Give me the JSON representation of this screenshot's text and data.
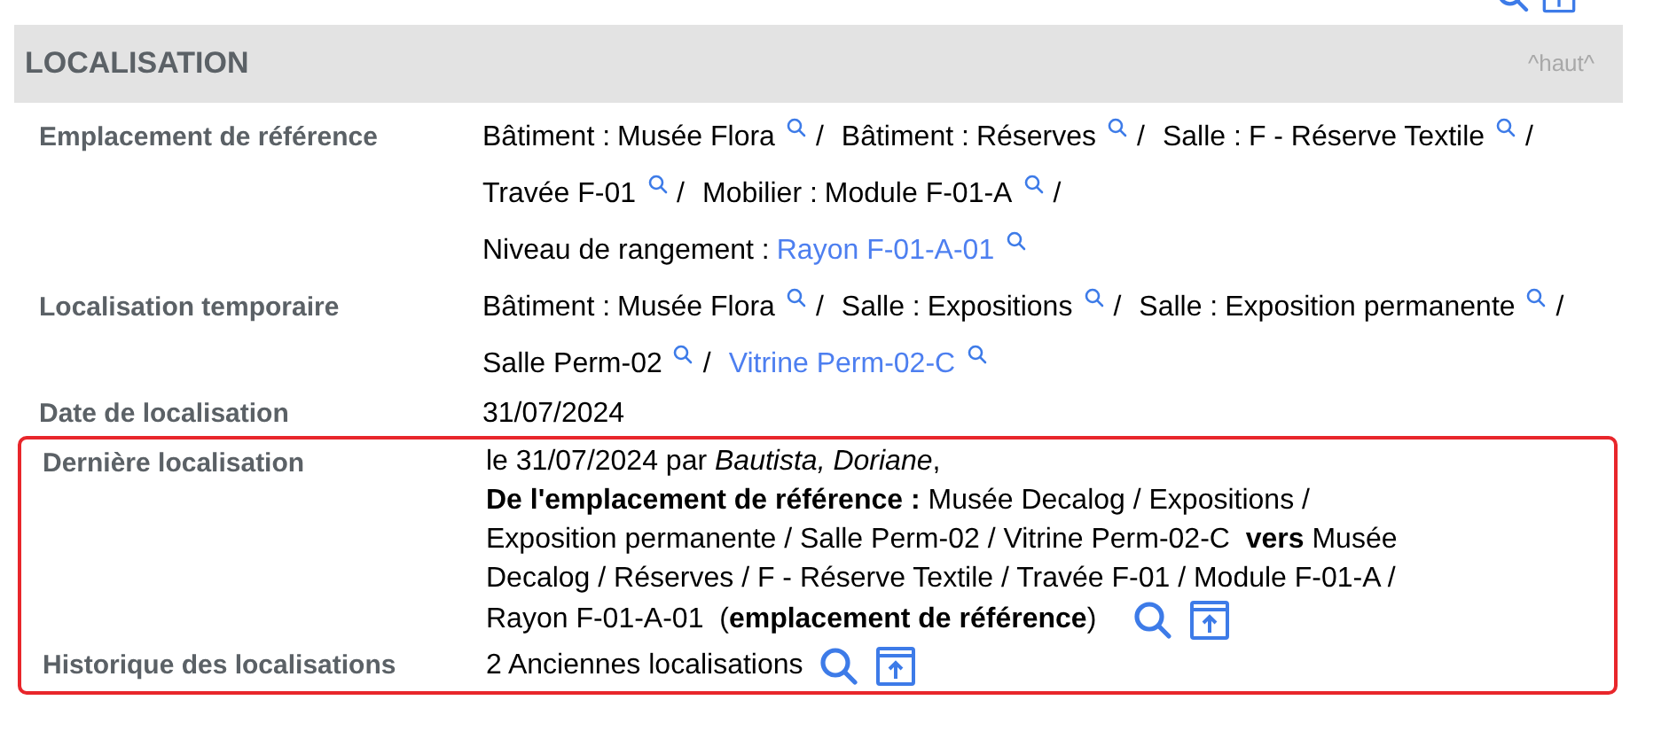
{
  "section": {
    "title": "LOCALISATION",
    "top_link": "^haut^"
  },
  "rows": [
    {
      "kind": "path",
      "label": "Emplacement de référence",
      "highlighted": false,
      "segments": [
        {
          "prefix": "Bâtiment :",
          "value": "Musée Flora",
          "link": false,
          "separator": "/"
        },
        {
          "prefix": "Bâtiment :",
          "value": "Réserves",
          "link": false,
          "separator": "/"
        },
        {
          "prefix": "Salle :",
          "value": "F - Réserve Textile",
          "link": false,
          "separator": "/"
        },
        {
          "value": "Travée F-01",
          "link": false,
          "separator": "/"
        },
        {
          "prefix": "Mobilier :",
          "value": "Module F-01-A",
          "link": false,
          "separator": "/"
        },
        {
          "prefix": "Niveau de rangement :",
          "value": "Rayon F-01-A-01",
          "link": true
        }
      ]
    },
    {
      "kind": "path",
      "label": "Localisation temporaire",
      "highlighted": false,
      "segments": [
        {
          "prefix": "Bâtiment :",
          "value": "Musée Flora",
          "link": false,
          "separator": "/"
        },
        {
          "prefix": "Salle :",
          "value": "Expositions",
          "link": false,
          "separator": "/"
        },
        {
          "prefix": "Salle :",
          "value": "Exposition permanente",
          "link": false,
          "separator": "/"
        },
        {
          "value": "Salle Perm-02",
          "link": false,
          "separator": "/"
        },
        {
          "value": "Vitrine Perm-02-C",
          "link": true
        }
      ]
    },
    {
      "kind": "text",
      "label": "Date de localisation",
      "highlighted": false,
      "value": "31/07/2024"
    },
    {
      "kind": "movement",
      "label": "Dernière localisation",
      "highlighted": true,
      "lines": [
        "le 31/07/2024 par *Bautista, Doriane*,",
        "**De l'emplacement de référence :** Musée Decalog / Expositions /",
        "Exposition permanente / Salle Perm-02 / Vitrine Perm-02-C  **vers** Musée",
        "Decalog / Réserves / F - Réserve Textile / Travée F-01 / Module F-01-A /",
        "Rayon F-01-A-01  (**emplacement de référence**)"
      ]
    },
    {
      "kind": "history",
      "label": "Historique des localisations",
      "highlighted": true,
      "value": "2 Anciennes localisations"
    }
  ]
}
